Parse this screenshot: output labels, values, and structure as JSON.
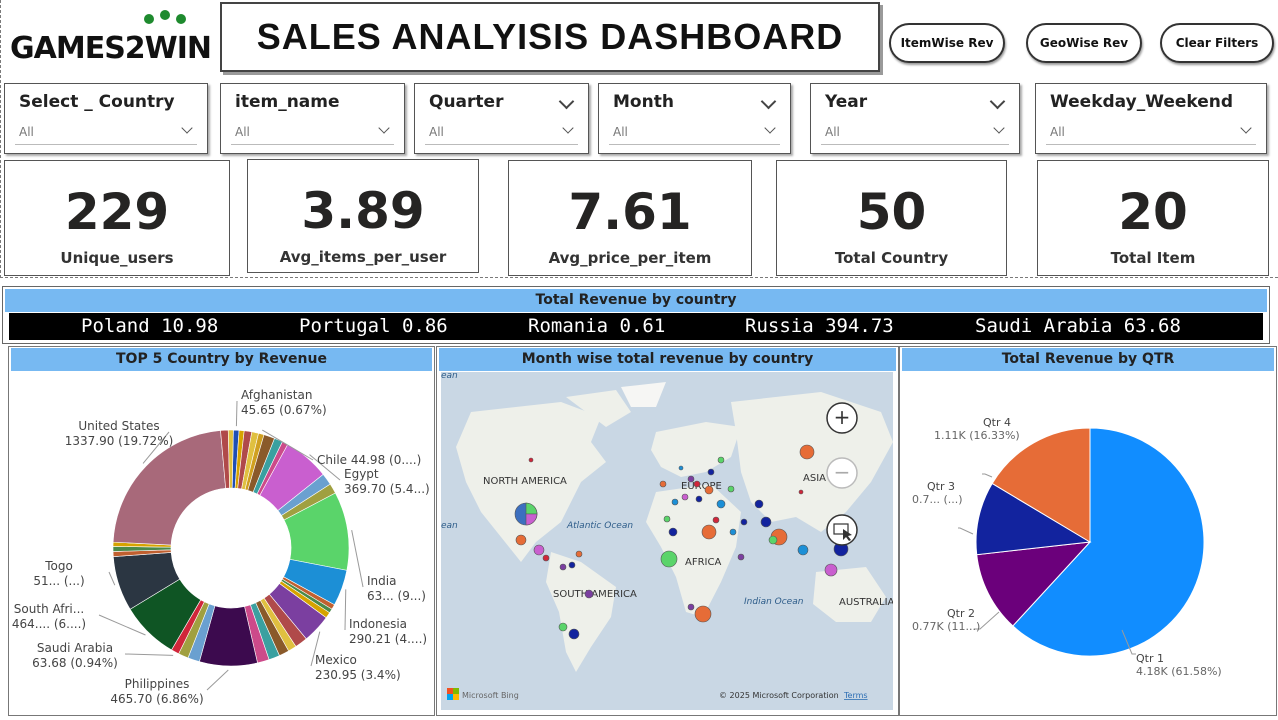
{
  "header": {
    "logo_text": "GAMES2WIN",
    "title": "SALES ANALYISIS DASHBOARD",
    "buttons": [
      {
        "label": "ItemWise Rev"
      },
      {
        "label": "GeoWise Rev"
      },
      {
        "label": "Clear Filters"
      }
    ]
  },
  "slicers": [
    {
      "title": "Select _ Country",
      "value": "All",
      "header_chevron": false
    },
    {
      "title": "item_name",
      "value": "All",
      "header_chevron": false
    },
    {
      "title": "Quarter",
      "value": "All",
      "header_chevron": true
    },
    {
      "title": "Month",
      "value": "All",
      "header_chevron": true
    },
    {
      "title": "Year",
      "value": "All",
      "header_chevron": true
    },
    {
      "title": "Weekday_Weekend",
      "value": "All",
      "header_chevron": false
    }
  ],
  "kpis": [
    {
      "value": "229",
      "label": "Unique_users"
    },
    {
      "value": "3.89",
      "label": "Avg_items_per_user"
    },
    {
      "value": "7.61",
      "label": "Avg_price_per_item"
    },
    {
      "value": "50",
      "label": "Total Country"
    },
    {
      "value": "20",
      "label": "Total Item"
    }
  ],
  "ticker": {
    "title": "Total Revenue by country",
    "items": [
      {
        "country": "Poland",
        "value": "10.98",
        "text": "Poland 10.98"
      },
      {
        "country": "Portugal",
        "value": "0.86",
        "text": "Portugal 0.86"
      },
      {
        "country": "Romania",
        "value": "0.61",
        "text": "Romania 0.61"
      },
      {
        "country": "Russia",
        "value": "394.73",
        "text": "Russia 394.73"
      },
      {
        "country": "Saudi Arabia",
        "value": "63.68",
        "text": "Saudi Arabia 63.68"
      }
    ]
  },
  "panels": {
    "donut_title": "TOP 5 Country by Revenue",
    "map_title": "Month wise total revenue by country",
    "pie_title": "Total Revenue by QTR"
  },
  "map": {
    "labels": {
      "north_america": "NORTH AMERICA",
      "europe": "EUROPE",
      "asia": "ASIA",
      "africa": "AFRICA",
      "south_america": "SOUTH AMERICA",
      "australia": "AUSTRALIA",
      "atlantic": "Atlantic Ocean",
      "indian": "Indian Ocean",
      "ocean_left_top": "ean",
      "ocean_left_mid": "ean"
    },
    "attribution_brand": "Microsoft Bing",
    "attribution": "© 2025 Microsoft Corporation",
    "terms": "Terms",
    "zoom_in_symbol": "+",
    "zoom_out_symbol": "−"
  },
  "chart_data": [
    {
      "type": "pie",
      "variant": "donut",
      "title": "TOP 5 Country by Revenue",
      "labelled_slices": [
        {
          "name": "United States",
          "value_label": "1337.90 (19.72%)",
          "percent": 19.72
        },
        {
          "name": "Afghanistan",
          "value_label": "45.65 (0.67%)",
          "percent": 0.67
        },
        {
          "name": "Chile",
          "value_label": "44.98 (0....)",
          "percent": 0.66
        },
        {
          "name": "Egypt",
          "value_label": "369.70 (5.4...)",
          "percent": 5.45
        },
        {
          "name": "India",
          "value_label": "63... (9...)",
          "percent": 9.3
        },
        {
          "name": "Indonesia",
          "value_label": "290.21 (4....)",
          "percent": 4.28
        },
        {
          "name": "Mexico",
          "value_label": "230.95 (3.4%)",
          "percent": 3.4
        },
        {
          "name": "Philippines",
          "value_label": "465.70 (6.86%)",
          "percent": 6.86
        },
        {
          "name": "Saudi Arabia",
          "value_label": "63.68 (0.94%)",
          "percent": 0.94
        },
        {
          "name": "South Afri...",
          "value_label": "464.... (6....)",
          "percent": 6.84
        },
        {
          "name": "Togo",
          "value_label": "51... (...)",
          "percent": 6.5
        }
      ],
      "colors": {
        "United States": "#a8697a",
        "Afghanistan": "#1f4eb4",
        "Egypt": "#c95fcf",
        "India": "#5ad46a",
        "Indonesia": "#1c8fd6",
        "Mexico": "#7b3fa0",
        "Philippines": "#3c0a4e",
        "Saudi Arabia": "#d0263a",
        "South Afri...": "#0f5524",
        "Togo": "#2b3642"
      }
    },
    {
      "type": "pie",
      "title": "Total Revenue by QTR",
      "categories": [
        "Qtr 1",
        "Qtr 2",
        "Qtr 3",
        "Qtr 4"
      ],
      "values": [
        4.18,
        0.77,
        0.7,
        1.11
      ],
      "units": "K",
      "labels": [
        {
          "name": "Qtr 1",
          "value_label": "4.18K (61.58%)"
        },
        {
          "name": "Qtr 2",
          "value_label": "0.77K (11...)"
        },
        {
          "name": "Qtr 3",
          "value_label": "0.7... (...)"
        },
        {
          "name": "Qtr 4",
          "value_label": "1.11K (16.33%)"
        }
      ],
      "colors": [
        "#118dff",
        "#6b007b",
        "#12239e",
        "#e66c37"
      ]
    }
  ]
}
